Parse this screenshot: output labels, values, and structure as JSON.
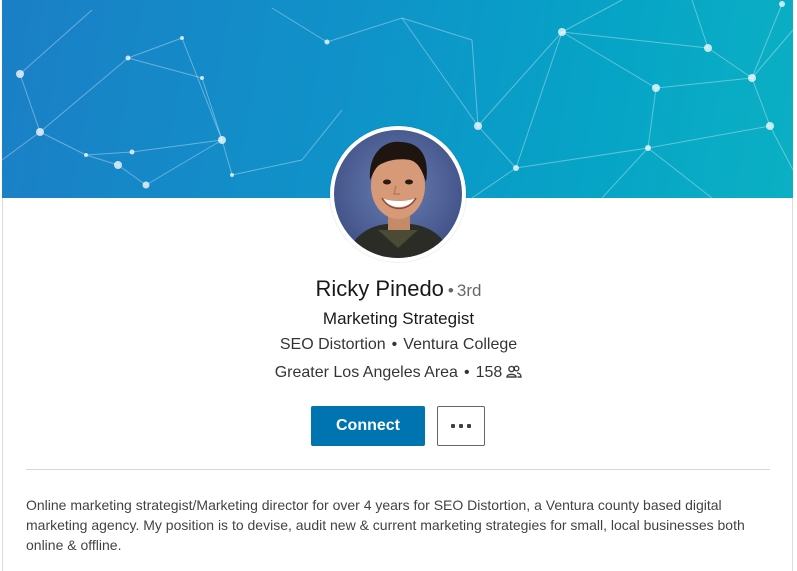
{
  "profile": {
    "name": "Ricky Pinedo",
    "degree_bullet": "•",
    "degree": "3rd",
    "headline": "Marketing Strategist",
    "company": "SEO Distortion",
    "school": "Ventura College",
    "location": "Greater Los Angeles Area",
    "connections": "158",
    "separator": "•",
    "summary": "Online marketing strategist/Marketing director for over 4 years for SEO Distortion, a Ventura county based digital marketing agency. My position is to devise, audit new & current marketing strategies for small, local businesses both online & offline."
  },
  "actions": {
    "connect_label": "Connect",
    "more_icon": "more-horizontal-icon"
  },
  "icons": {
    "connections": "people-icon"
  },
  "colors": {
    "primary": "#0073b1",
    "banner_start": "#1b7fc6",
    "banner_end": "#0bb0c4"
  }
}
